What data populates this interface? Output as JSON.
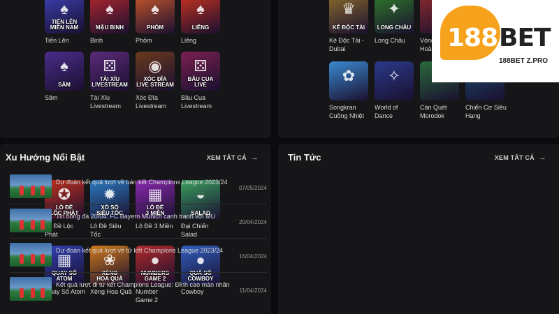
{
  "top_left_games": [
    {
      "thumb": "TIẾN LÊN\nMIỀN NAM",
      "name": "Tiến Lên",
      "bg": "#3b3fb0",
      "icon": "cards-icon"
    },
    {
      "thumb": "MẬU BINH",
      "name": "Binh",
      "bg": "#b0262d",
      "icon": "cards-icon"
    },
    {
      "thumb": "PHỎM",
      "name": "Phỏm",
      "bg": "#c7562a",
      "icon": "cards-icon"
    },
    {
      "thumb": "LIÊNG",
      "name": "Liêng",
      "bg": "#c8321f",
      "icon": "cards-icon"
    },
    {
      "thumb": "SÂM",
      "name": "Sâm",
      "bg": "#4a2c8a",
      "icon": "cards-icon"
    },
    {
      "thumb": "TÀI XỈU\nLIVESTREAM",
      "name": "Tài Xỉu\nLivestream",
      "bg": "#5b2a78",
      "icon": "dice-icon"
    },
    {
      "thumb": "XÓC ĐĨA\nLIVE STREAM",
      "name": "Xóc Đĩa\nLivestream",
      "bg": "#6b3a1e",
      "icon": "disc-icon"
    },
    {
      "thumb": "BẦU CUA LIVE",
      "name": "Bầu Cua\nLivestream",
      "bg": "#7a2050",
      "icon": "dice-icon"
    }
  ],
  "top_right_games": [
    {
      "thumb": "KẺ ĐỘC TÀI",
      "name": "Kẻ Độc Tài -\nDubai",
      "bg": "#8a6a2a",
      "icon": "crown-icon"
    },
    {
      "thumb": "LONG CHÂU",
      "name": "Long Châu",
      "bg": "#2f7a2a",
      "icon": "dragon-icon"
    },
    {
      "thumb": "",
      "name": "Vòng\nHoà",
      "bg": "#8a2a2a",
      "icon": "wheel-icon"
    },
    {
      "thumb": "",
      "name": "Songkran\nCuồng Nhiệt",
      "bg": "#3a8ad0",
      "icon": "splash-icon"
    },
    {
      "thumb": "",
      "name": "World of\nDance",
      "bg": "#2a3a8a",
      "icon": "dance-icon"
    },
    {
      "thumb": "",
      "name": "Càn Quét\nMorodok",
      "bg": "#2a6a3a",
      "icon": "ball-icon"
    },
    {
      "thumb": "",
      "name": "Chiến Cơ Siêu\nHạng",
      "bg": "#1e4a6a",
      "icon": "ball-icon"
    }
  ],
  "trending": {
    "title": "Xu Hướng Nổi Bật",
    "see_all": "XEM TẤT CẢ",
    "games": [
      {
        "thumb": "LÔ ĐỀ\nLỘC PHÁT",
        "name": "Lô Đề Lộc\nPhát",
        "bg": "#c0301e",
        "icon": "bell-icon"
      },
      {
        "thumb": "XỔ SỐ\nSIÊU TỐC",
        "name": "Lô Đề Siêu\nTốc",
        "bg": "#2a7ac0",
        "icon": "lottery-icon"
      },
      {
        "thumb": "LÔ ĐỀ\n3 MIỀN",
        "name": "Lô Đề 3 Miền",
        "bg": "#8a2ab0",
        "icon": "grid-icon"
      },
      {
        "thumb": "SALAD",
        "name": "Đại Chiến\nSalad",
        "bg": "#3aa060",
        "icon": "bowl-icon"
      },
      {
        "thumb": "QUAY SỐ\nATOM",
        "name": "Quay Số Atom",
        "bg": "#3040b0",
        "icon": "grid-icon"
      },
      {
        "thumb": "XÈNG\nHOA QUẢ",
        "name": "Xèng Hoa Quả",
        "bg": "#d07a1a",
        "icon": "fruit-icon"
      },
      {
        "thumb": "NUMBERS\nGAME 2",
        "name": "Number\nGame 2",
        "bg": "#b02a2a",
        "icon": "ball-icon"
      },
      {
        "thumb": "QUẢ SỐ\nCOWBOY",
        "name": "Cowboy",
        "bg": "#3060c0",
        "icon": "ball-icon"
      }
    ]
  },
  "news": {
    "title": "Tin Tức",
    "see_all": "XEM TẤT CẢ",
    "items": [
      {
        "title": "Dự đoán kết quả lượt về bán kết Champions League 2023/24",
        "date": "07/05/2024"
      },
      {
        "title": "Tin bóng đá 20/04: FC Bayern Munich cạnh tranh với MU",
        "date": "20/04/2024"
      },
      {
        "title": "Dự đoán kết quả lượt về tứ kết Champions League 2023/24",
        "date": "16/04/2024"
      },
      {
        "title": "Kết quả lượt đi tứ kết Champions League: Đỉnh cao màn nhãn",
        "date": "11/04/2024"
      }
    ]
  },
  "logo": {
    "num": "188",
    "bet": "BET",
    "sub": "188BET Z.PRO"
  }
}
